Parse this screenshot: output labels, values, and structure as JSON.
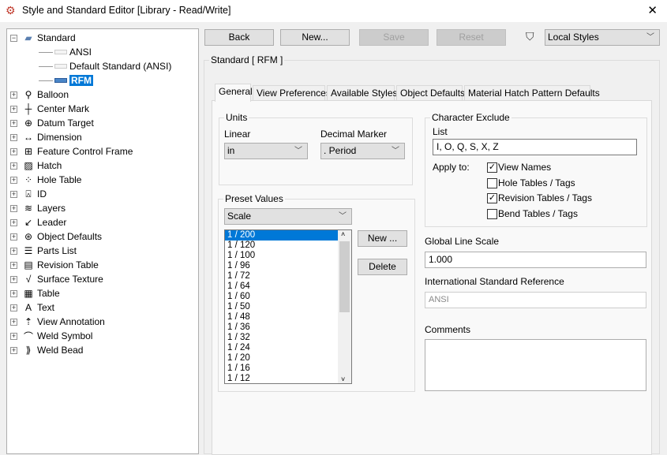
{
  "window": {
    "title": "Style and Standard Editor [Library - Read/Write]",
    "close": "✕"
  },
  "toolbar": {
    "back": "Back",
    "new": "New...",
    "save": "Save",
    "reset": "Reset",
    "filter_value": "Local Styles"
  },
  "tree": {
    "root": "Standard",
    "standards": [
      {
        "label": "ANSI"
      },
      {
        "label": "Default Standard (ANSI)"
      },
      {
        "label": "RFM",
        "selected": true
      }
    ],
    "items": [
      {
        "label": "Balloon",
        "icon": "balloon-icon",
        "glyph": "⚲"
      },
      {
        "label": "Center Mark",
        "icon": "center-mark-icon",
        "glyph": "┼"
      },
      {
        "label": "Datum Target",
        "icon": "datum-target-icon",
        "glyph": "⊕"
      },
      {
        "label": "Dimension",
        "icon": "dimension-icon",
        "glyph": "↔"
      },
      {
        "label": "Feature Control Frame",
        "icon": "feature-control-frame-icon",
        "glyph": "⊞"
      },
      {
        "label": "Hatch",
        "icon": "hatch-icon",
        "glyph": "▨"
      },
      {
        "label": "Hole Table",
        "icon": "hole-table-icon",
        "glyph": "⁘"
      },
      {
        "label": "ID",
        "icon": "id-icon",
        "glyph": "⍓"
      },
      {
        "label": "Layers",
        "icon": "layers-icon",
        "glyph": "≋"
      },
      {
        "label": "Leader",
        "icon": "leader-icon",
        "glyph": "↙"
      },
      {
        "label": "Object Defaults",
        "icon": "globe-icon",
        "glyph": "⊛"
      },
      {
        "label": "Parts List",
        "icon": "parts-list-icon",
        "glyph": "☰"
      },
      {
        "label": "Revision Table",
        "icon": "revision-table-icon",
        "glyph": "▤"
      },
      {
        "label": "Surface Texture",
        "icon": "surface-texture-icon",
        "glyph": "√"
      },
      {
        "label": "Table",
        "icon": "table-icon",
        "glyph": "▦"
      },
      {
        "label": "Text",
        "icon": "text-icon",
        "glyph": "A"
      },
      {
        "label": "View Annotation",
        "icon": "view-annotation-icon",
        "glyph": "⇡"
      },
      {
        "label": "Weld Symbol",
        "icon": "weld-symbol-icon",
        "glyph": "⌒"
      },
      {
        "label": "Weld Bead",
        "icon": "weld-bead-icon",
        "glyph": "⟫"
      }
    ]
  },
  "main": {
    "heading": "Standard [ RFM ]",
    "tabs": [
      "General",
      "View Preferences",
      "Available Styles",
      "Object Defaults",
      "Material Hatch Pattern Defaults"
    ],
    "units": {
      "title": "Units",
      "linear_label": "Linear",
      "linear_value": "in",
      "decimal_label": "Decimal Marker",
      "decimal_value": ". Period"
    },
    "preset": {
      "title": "Preset Values",
      "type": "Scale",
      "new": "New ...",
      "delete": "Delete",
      "values": [
        "1 / 200",
        "1 / 120",
        "1 / 100",
        "1 / 96",
        "1 / 72",
        "1 / 64",
        "1 / 60",
        "1 / 50",
        "1 / 48",
        "1 / 36",
        "1 / 32",
        "1 / 24",
        "1 / 20",
        "1 / 16",
        "1 / 12"
      ]
    },
    "char_exclude": {
      "title": "Character Exclude",
      "list_label": "List",
      "list_value": "I, O, Q, S, X, Z",
      "apply_label": "Apply to:",
      "options": [
        {
          "label": "View Names",
          "checked": true
        },
        {
          "label": "Hole Tables / Tags",
          "checked": false
        },
        {
          "label": "Revision Tables / Tags",
          "checked": true
        },
        {
          "label": "Bend Tables / Tags",
          "checked": false
        }
      ]
    },
    "global_line_scale_label": "Global Line Scale",
    "global_line_scale": "1.000",
    "isr_label": "International Standard Reference",
    "isr_value": "ANSI",
    "comments_label": "Comments",
    "comments": ""
  },
  "colors": {
    "selection": "#0078d7"
  }
}
